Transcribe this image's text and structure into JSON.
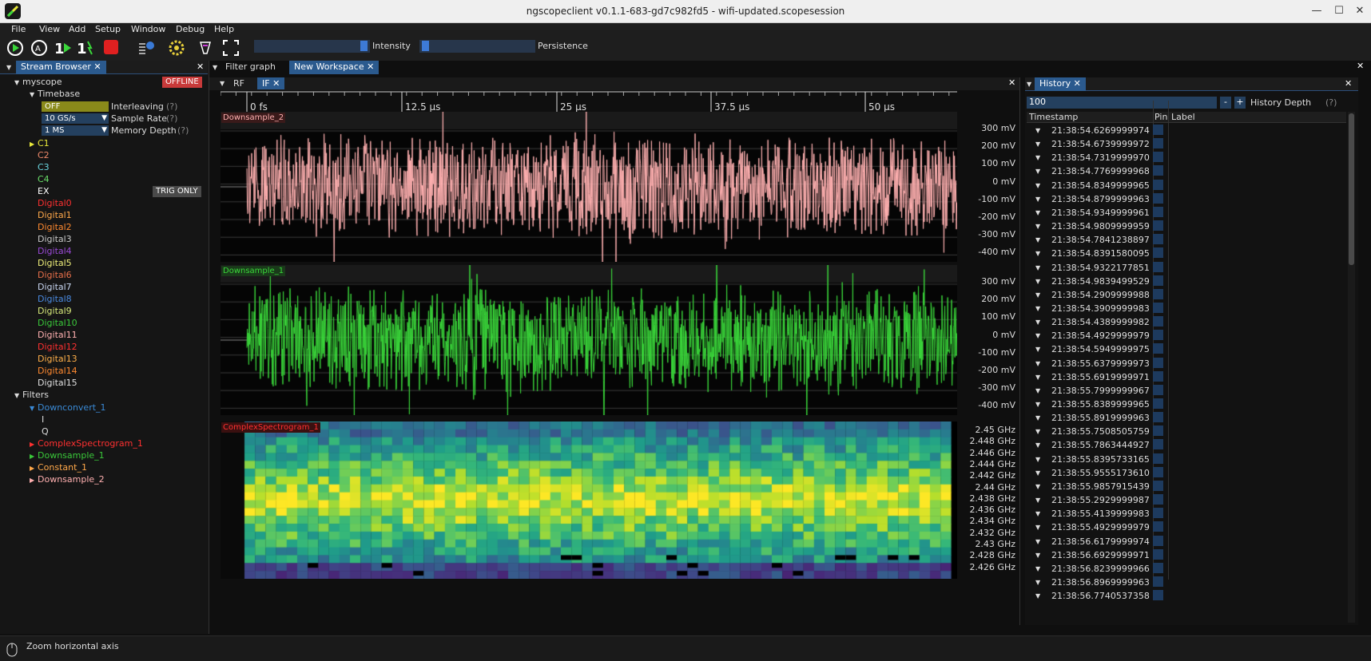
{
  "window": {
    "title": "ngscopeclient v0.1.1-683-gd7c982fd5  - wifi-updated.scopesession"
  },
  "menu": [
    "File",
    "View",
    "Add",
    "Setup",
    "Window",
    "Debug",
    "Help"
  ],
  "toolbar": {
    "intensity_label": "Intensity",
    "persistence_label": "Persistence"
  },
  "left_panel": {
    "tab": "Stream Browser",
    "scope_name": "myscope",
    "scope_status": "OFFLINE",
    "timebase": "Timebase",
    "interleaving": {
      "value": "OFF",
      "label": "Interleaving",
      "help": "(?)"
    },
    "sample_rate": {
      "value": "10 GS/s",
      "label": "Sample Rate",
      "help": "(?)"
    },
    "memory_depth": {
      "value": "1 MS",
      "label": "Memory Depth",
      "help": "(?)"
    },
    "channels": [
      {
        "name": "C1",
        "color": "#e8e83a",
        "caret": true
      },
      {
        "name": "C2",
        "color": "#f08a6a"
      },
      {
        "name": "C3",
        "color": "#6ad6e0"
      },
      {
        "name": "C4",
        "color": "#6ae06a"
      },
      {
        "name": "EX",
        "color": "#ffffff",
        "badge": "TRIG ONLY"
      },
      {
        "name": "Digital0",
        "color": "#ff3030"
      },
      {
        "name": "Digital1",
        "color": "#ffa84a"
      },
      {
        "name": "Digital2",
        "color": "#ff8a30"
      },
      {
        "name": "Digital3",
        "color": "#c8c8c8"
      },
      {
        "name": "Digital4",
        "color": "#9a4ad6"
      },
      {
        "name": "Digital5",
        "color": "#f0f07a"
      },
      {
        "name": "Digital6",
        "color": "#e8704a"
      },
      {
        "name": "Digital7",
        "color": "#c8d6f0"
      },
      {
        "name": "Digital8",
        "color": "#4a8ae0"
      },
      {
        "name": "Digital9",
        "color": "#d6e87a"
      },
      {
        "name": "Digital10",
        "color": "#3ac83a"
      },
      {
        "name": "Digital11",
        "color": "#ffb0b0"
      },
      {
        "name": "Digital12",
        "color": "#ff3030"
      },
      {
        "name": "Digital13",
        "color": "#ffb04a"
      },
      {
        "name": "Digital14",
        "color": "#ff8a30"
      },
      {
        "name": "Digital15",
        "color": "#e0e0e0"
      }
    ],
    "filters_label": "Filters",
    "filters": [
      {
        "name": "Downconvert_1",
        "color": "#3a8ad6",
        "open": true,
        "children": [
          "I",
          "Q"
        ]
      },
      {
        "name": "ComplexSpectrogram_1",
        "color": "#ff3030"
      },
      {
        "name": "Downsample_1",
        "color": "#3ac83a"
      },
      {
        "name": "Constant_1",
        "color": "#ffa84a"
      },
      {
        "name": "Downsample_2",
        "color": "#ffb0b0"
      }
    ]
  },
  "center": {
    "tab_filter_graph": "Filter graph",
    "tab_workspace": "New Workspace",
    "subtab_rf": "RF",
    "subtab_if": "IF",
    "time_ticks": [
      "0 fs",
      "12.5 µs",
      "25 µs",
      "37.5 µs",
      "50 µs"
    ],
    "plots": [
      {
        "name": "Downsample_2",
        "color": "#ffb0b0",
        "labels": [
          "300 mV",
          "200 mV",
          "100 mV",
          "0 mV",
          "-100 mV",
          "-200 mV",
          "-300 mV",
          "-400 mV"
        ]
      },
      {
        "name": "Downsample_1",
        "color": "#3ad63a",
        "labels": [
          "300 mV",
          "200 mV",
          "100 mV",
          "0 mV",
          "-100 mV",
          "-200 mV",
          "-300 mV",
          "-400 mV"
        ]
      },
      {
        "name": "ComplexSpectrogram_1",
        "color": "#ff3030",
        "labels": [
          "2.45 GHz",
          "2.448 GHz",
          "2.446 GHz",
          "2.444 GHz",
          "2.442 GHz",
          "2.44 GHz",
          "2.438 GHz",
          "2.436 GHz",
          "2.434 GHz",
          "2.432 GHz",
          "2.43 GHz",
          "2.428 GHz",
          "2.426 GHz"
        ]
      }
    ]
  },
  "history": {
    "tab": "History",
    "depth_value": "100",
    "depth_label": "History Depth",
    "help": "(?)",
    "minus": "-",
    "plus": "+",
    "col_timestamp": "Timestamp",
    "col_pin": "Pin",
    "col_label": "Label",
    "rows": [
      "21:38:54.6269999974",
      "21:38:54.6739999972",
      "21:38:54.7319999970",
      "21:38:54.7769999968",
      "21:38:54.8349999965",
      "21:38:54.8799999963",
      "21:38:54.9349999961",
      "21:38:54.9809999959",
      "21:38:54.7841238897",
      "21:38:54.8391580095",
      "21:38:54.9322177851",
      "21:38:54.9839499529",
      "21:38:54.2909999988",
      "21:38:54.3909999983",
      "21:38:54.4389999982",
      "21:38:54.4929999979",
      "21:38:54.5949999975",
      "21:38:55.6379999973",
      "21:38:55.6919999971",
      "21:38:55.7999999967",
      "21:38:55.8389999965",
      "21:38:55.8919999963",
      "21:38:55.7508505759",
      "21:38:55.7863444927",
      "21:38:55.8395733165",
      "21:38:55.9555173610",
      "21:38:55.9857915439",
      "21:38:55.2929999987",
      "21:38:55.4139999983",
      "21:38:55.4929999979",
      "21:38:56.6179999974",
      "21:38:56.6929999971",
      "21:38:56.8239999966",
      "21:38:56.8969999963",
      "21:38:56.7740537358"
    ]
  },
  "status": {
    "text": "Zoom horizontal axis"
  }
}
